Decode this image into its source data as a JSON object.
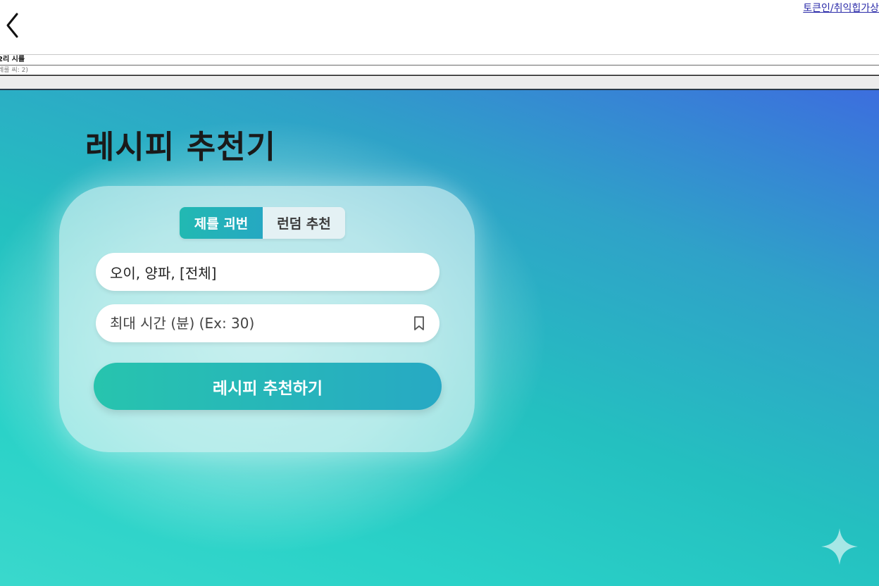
{
  "header": {
    "top_link": "토큰인/취익힙가상"
  },
  "strips": {
    "line1": "2리 시룰",
    "line2": "레룰 씨: 2)"
  },
  "main": {
    "title": "레시피 추천기",
    "tabs": [
      {
        "label": "제를 괴번",
        "active": true
      },
      {
        "label": "런덤 추천",
        "active": false
      }
    ],
    "ingredients": {
      "value": "오이, 양파, [전체]",
      "placeholder": ""
    },
    "max_time": {
      "value": "",
      "placeholder": "최대 시간 (뷴) (Ex: 30)"
    },
    "submit_label": "레시피 추천하기"
  },
  "icons": {
    "back": "chevron-left-icon",
    "bookmark": "bookmark-icon",
    "sparkle": "sparkle-icon"
  },
  "colors": {
    "accent": "#22b9b2",
    "gradient_top_right": "#3c6ede",
    "gradient_bottom_left": "#3ad8cc"
  }
}
